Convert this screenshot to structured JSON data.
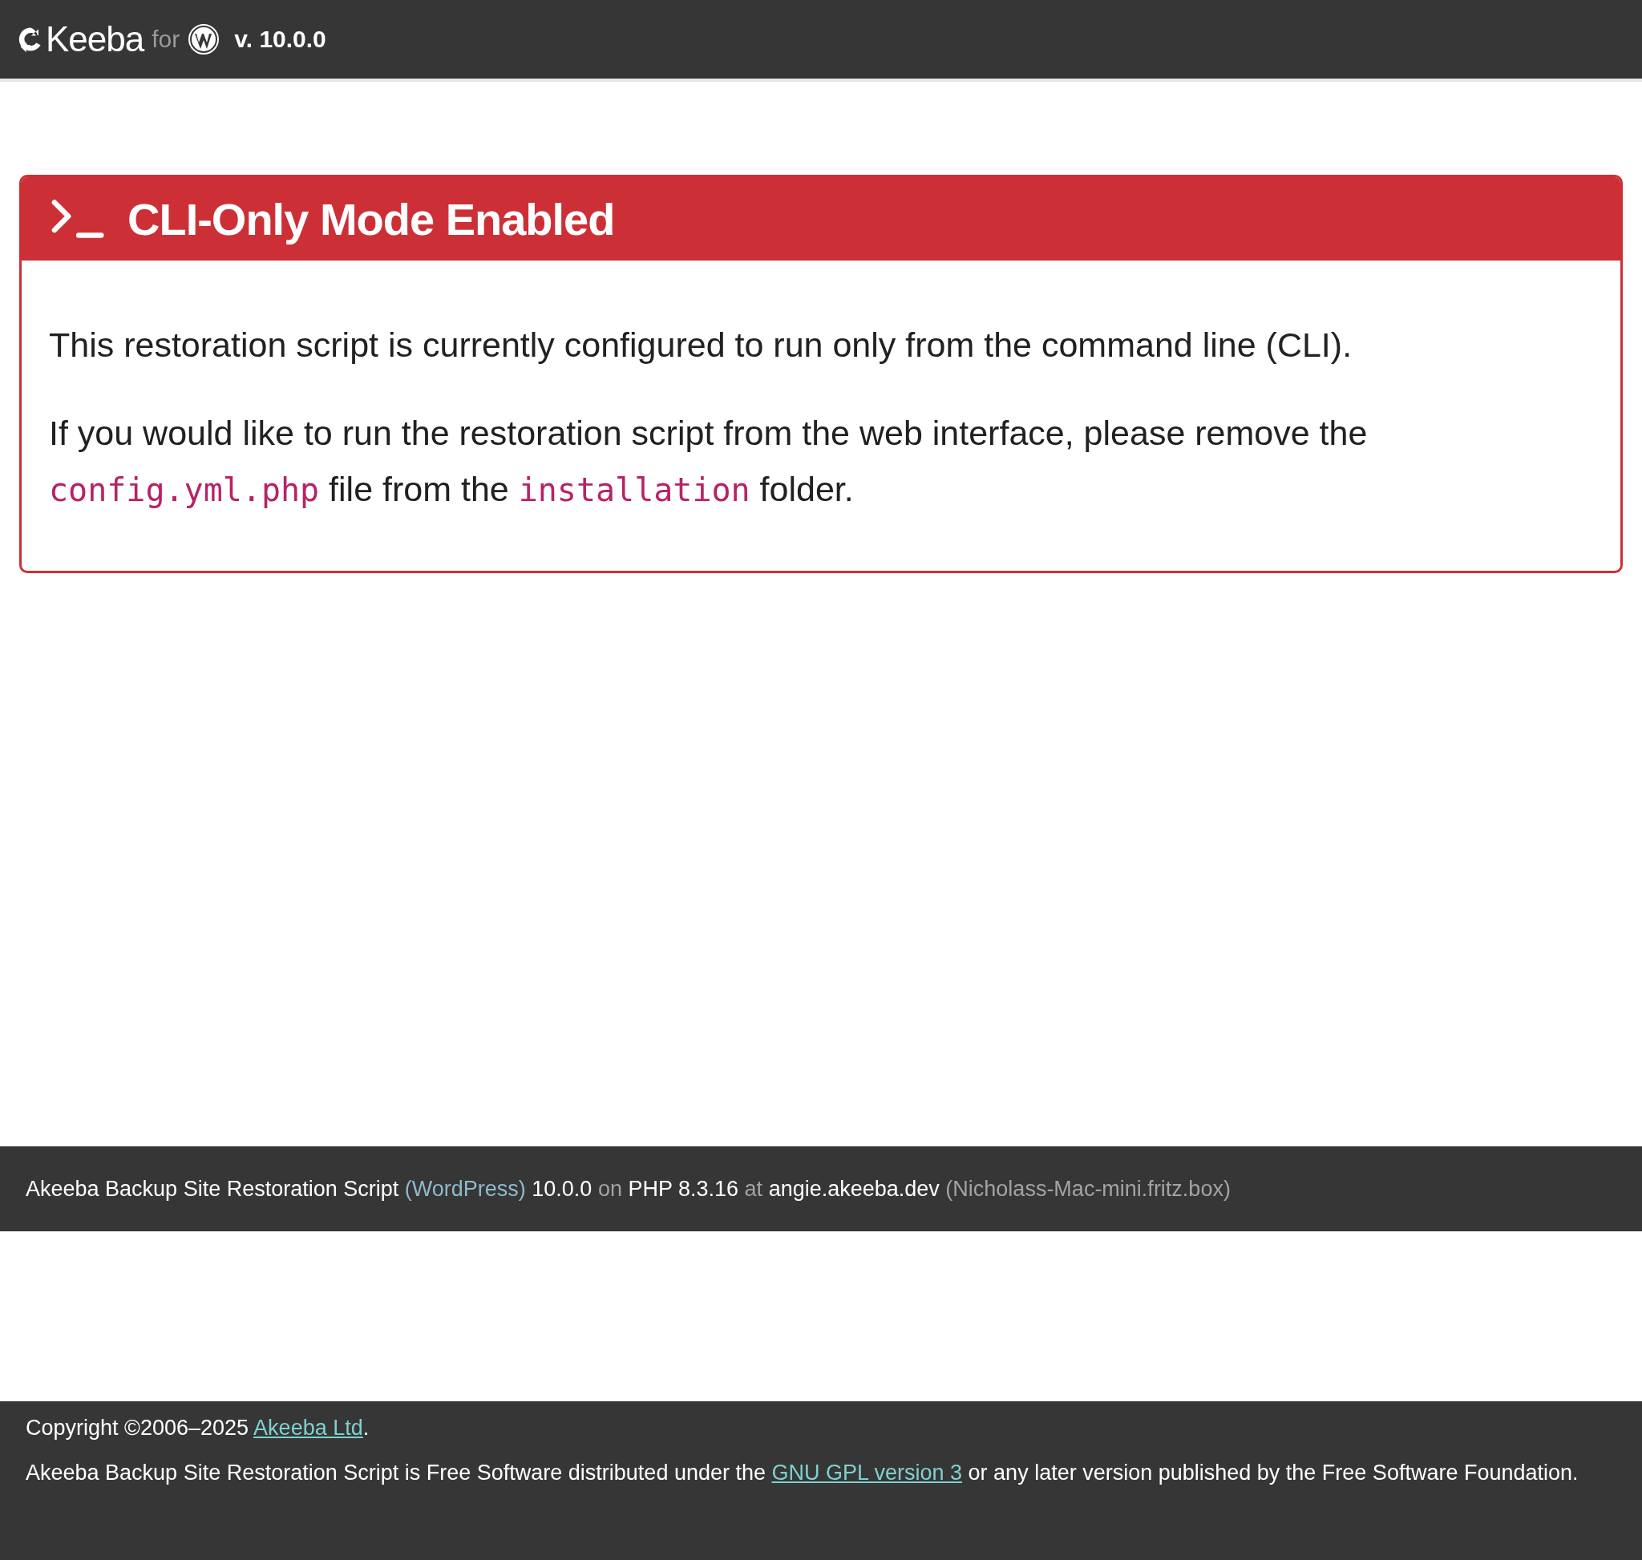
{
  "header": {
    "logo": "**K**eeba",
    "for": "for",
    "version": "v. 10.0.0"
  },
  "alert": {
    "title": "CLI-Only Mode Enabled",
    "paragraphs": [
      [
        {
          "kind": "text",
          "text": "This restoration script is currently configured to run only from the command line (CLI)."
        }
      ],
      [
        {
          "kind": "text",
          "text": "If you would like to run the restoration script from the web interface, please remove the "
        },
        {
          "kind": "code",
          "text": "config.yml.php"
        },
        {
          "kind": "text",
          "text": " file from the "
        },
        {
          "kind": "code",
          "text": "installation"
        },
        {
          "kind": "text",
          "text": " folder."
        }
      ]
    ]
  },
  "status_bar": [
    {
      "kind": "strong",
      "text": "Akeeba Backup Site Restoration Script"
    },
    {
      "kind": "accent",
      "text": "(WordPress)"
    },
    {
      "kind": "strong",
      "text": "10.0.0"
    },
    {
      "kind": "muted",
      "text": "on"
    },
    {
      "kind": "strong",
      "text": "PHP 8.3.16"
    },
    {
      "kind": "muted",
      "text": "at"
    },
    {
      "kind": "strong",
      "text": "angie.akeeba.dev"
    },
    {
      "kind": "muted",
      "text": "(Nicholass-Mac-mini.fritz.box)"
    }
  ],
  "footer": [
    {
      "before": "Copyright ©2006–2025 ",
      "link": "Akeeba Ltd",
      "after": "."
    },
    {
      "before": "Akeeba Backup Site Restoration Script is Free Software distributed under the ",
      "link": "GNU GPL version 3",
      "after": " or any later version published by the Free Software Foundation."
    }
  ]
}
